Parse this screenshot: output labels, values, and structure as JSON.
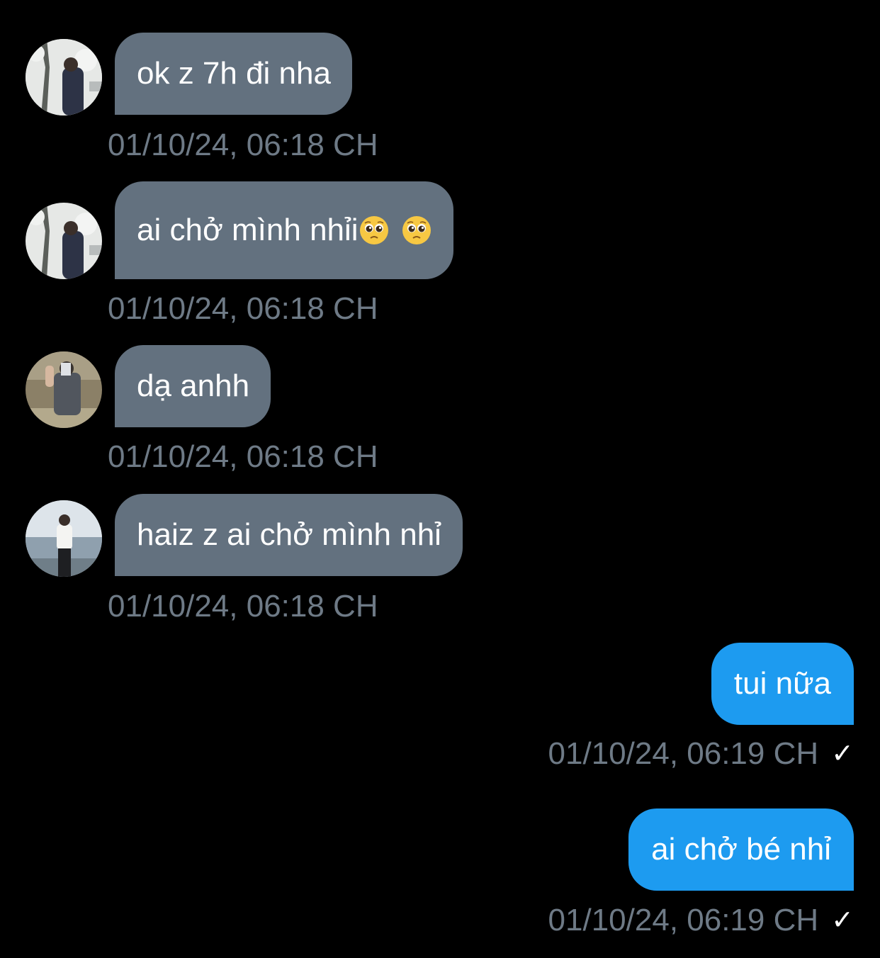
{
  "conversation": {
    "messages": [
      {
        "direction": "incoming",
        "text": "ok z 7h đi nha",
        "time": "01/10/24, 06:18 CH",
        "avatar": "avatar-cherry-blossom"
      },
      {
        "direction": "incoming",
        "text": "ai chở mình nhỉi",
        "emoji": [
          "pleading-face-emoji",
          "pleading-face-emoji"
        ],
        "time": "01/10/24, 06:18 CH",
        "avatar": "avatar-cherry-blossom"
      },
      {
        "direction": "incoming",
        "text": "dạ anhh",
        "time": "01/10/24, 06:18 CH",
        "avatar": "avatar-mirror-selfie"
      },
      {
        "direction": "incoming",
        "text": "haiz z ai chở mình nhỉ",
        "time": "01/10/24, 06:18 CH",
        "avatar": "avatar-seaside"
      },
      {
        "direction": "outgoing",
        "text": "tui nữa",
        "time": "01/10/24, 06:19 CH",
        "status_icon": "check-icon"
      },
      {
        "direction": "outgoing",
        "text": "ai chở bé nhỉ",
        "time": "01/10/24, 06:19 CH",
        "status_icon": "check-icon"
      }
    ]
  },
  "colors": {
    "background": "#000000",
    "incoming_bubble": "#63717f",
    "outgoing_bubble": "#1d9bf0",
    "timestamp": "#6e7a86",
    "text": "#ffffff"
  },
  "icons": {
    "check": "✓"
  }
}
